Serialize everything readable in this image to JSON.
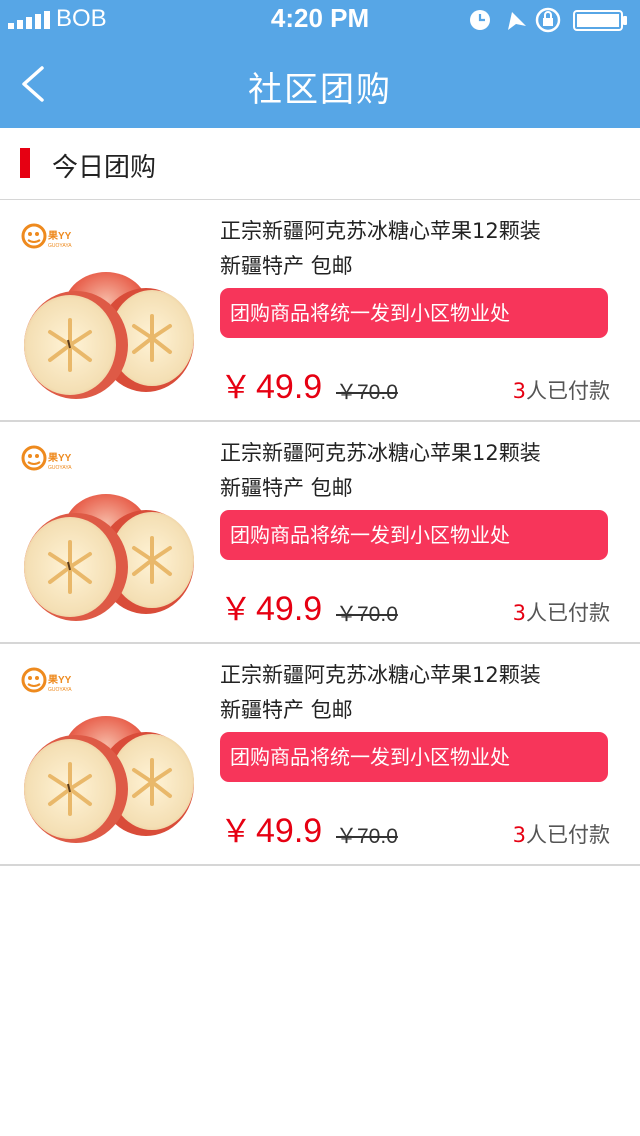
{
  "status_bar": {
    "carrier": "BOB",
    "time": "4:20 PM"
  },
  "nav": {
    "title": "社区团购",
    "back_icon": "chevron-left-icon"
  },
  "section": {
    "title": "今日团购",
    "accent_color": "#e60012"
  },
  "colors": {
    "nav_bg": "#57a6e6",
    "notice_bg": "#f7355a",
    "price": "#e60012"
  },
  "products": [
    {
      "name_line1": "正宗新疆阿克苏冰糖心苹果12颗装",
      "name_line2": "新疆特产  包邮",
      "notice": "团购商品将统一发到小区物业处",
      "currency": "￥",
      "price": "49.9",
      "original_price": "￥70.0",
      "paid_count": "3",
      "paid_suffix": "人已付款",
      "logo_text": "果YY",
      "logo_sub": "GUOYAYA"
    },
    {
      "name_line1": "正宗新疆阿克苏冰糖心苹果12颗装",
      "name_line2": "新疆特产  包邮",
      "notice": "团购商品将统一发到小区物业处",
      "currency": "￥",
      "price": "49.9",
      "original_price": "￥70.0",
      "paid_count": "3",
      "paid_suffix": "人已付款",
      "logo_text": "果YY",
      "logo_sub": "GUOYAYA"
    },
    {
      "name_line1": "正宗新疆阿克苏冰糖心苹果12颗装",
      "name_line2": "新疆特产  包邮",
      "notice": "团购商品将统一发到小区物业处",
      "currency": "￥",
      "price": "49.9",
      "original_price": "￥70.0",
      "paid_count": "3",
      "paid_suffix": "人已付款",
      "logo_text": "果YY",
      "logo_sub": "GUOYAYA"
    }
  ]
}
